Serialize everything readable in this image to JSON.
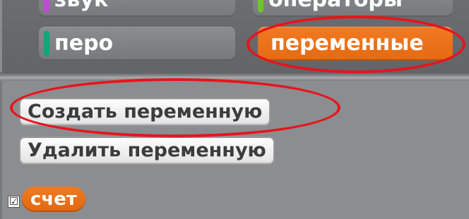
{
  "categories": {
    "row0": [
      {
        "label": "звук",
        "stripe_color": "#c04bd8"
      },
      {
        "label": "операторы",
        "stripe_color": "#6fc42a"
      }
    ],
    "row1": [
      {
        "label": "перо",
        "stripe_color": "#0fa878"
      },
      {
        "label": "переменные",
        "stripe_color": "#f07a23",
        "selected": true
      }
    ]
  },
  "palette": {
    "create_variable_label": "Создать переменную",
    "delete_variable_label": "Удалить переменную",
    "variables": [
      {
        "name": "счет",
        "checked": true,
        "check_glyph": "☑"
      }
    ]
  },
  "annotation_color": "#e8141c"
}
